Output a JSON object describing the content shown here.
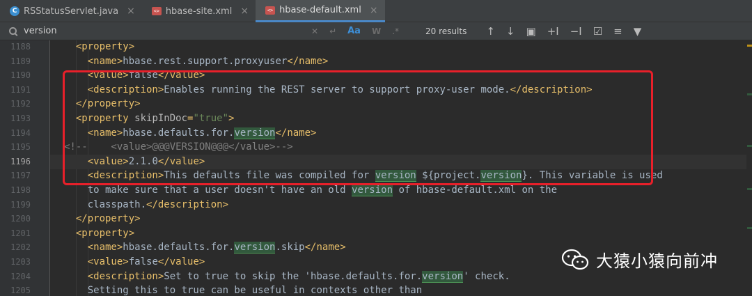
{
  "tabs": [
    {
      "label": "RSStatusServlet.java",
      "icon": "java-class-icon",
      "active": false
    },
    {
      "label": "hbase-site.xml",
      "icon": "xml-file-icon",
      "active": false
    },
    {
      "label": "hbase-default.xml",
      "icon": "xml-file-icon",
      "active": true
    }
  ],
  "search": {
    "query": "version",
    "results": "20 results",
    "match_case_label": "Aa",
    "words_label": "W",
    "regex_label": ".*"
  },
  "editor": {
    "lines": [
      {
        "n": "1188",
        "indent": 2,
        "parts": [
          [
            "tag",
            "<property>"
          ]
        ]
      },
      {
        "n": "1189",
        "indent": 4,
        "parts": [
          [
            "tag",
            "<name>"
          ],
          [
            "txt",
            "hbase.rest.support.proxyuser"
          ],
          [
            "tag",
            "</name>"
          ]
        ]
      },
      {
        "n": "1190",
        "indent": 4,
        "parts": [
          [
            "tag",
            "<value>"
          ],
          [
            "txt",
            "false"
          ],
          [
            "tag",
            "</value>"
          ]
        ]
      },
      {
        "n": "1191",
        "indent": 4,
        "parts": [
          [
            "tag",
            "<description>"
          ],
          [
            "txt",
            "Enables running the REST server to support proxy-user mode."
          ],
          [
            "tag",
            "</description>"
          ]
        ]
      },
      {
        "n": "1192",
        "indent": 2,
        "parts": [
          [
            "tag",
            "</property>"
          ]
        ]
      },
      {
        "n": "1193",
        "indent": 2,
        "parts": [
          [
            "tag",
            "<property "
          ],
          [
            "attr",
            "skipInDoc"
          ],
          [
            "tag",
            "="
          ],
          [
            "str",
            "\"true\""
          ],
          [
            "tag",
            ">"
          ]
        ]
      },
      {
        "n": "1194",
        "indent": 4,
        "parts": [
          [
            "tag",
            "<name>"
          ],
          [
            "txt",
            "hbase.defaults.for."
          ],
          [
            "hl",
            "version"
          ],
          [
            "tag",
            "</name>"
          ]
        ]
      },
      {
        "n": "1195",
        "indent": 0,
        "parts": [
          [
            "cmt",
            "<!--    <value>@@@VERSION@@@</value>-->"
          ]
        ]
      },
      {
        "n": "1196",
        "indent": 4,
        "current": true,
        "parts": [
          [
            "tag",
            "<value>"
          ],
          [
            "txt",
            "2.1.0"
          ],
          [
            "tag",
            "</value>"
          ]
        ]
      },
      {
        "n": "1197",
        "indent": 4,
        "parts": [
          [
            "tag",
            "<description>"
          ],
          [
            "txt",
            "This defaults file was compiled for "
          ],
          [
            "hl",
            "version"
          ],
          [
            "txt",
            " ${project."
          ],
          [
            "hl",
            "version"
          ],
          [
            "txt",
            "}. This variable is used"
          ]
        ]
      },
      {
        "n": "1198",
        "indent": 4,
        "parts": [
          [
            "txt",
            "to make sure that a user doesn't have an old "
          ],
          [
            "hl",
            "version"
          ],
          [
            "txt",
            " of hbase-default.xml on the"
          ]
        ]
      },
      {
        "n": "1199",
        "indent": 4,
        "parts": [
          [
            "txt",
            "classpath."
          ],
          [
            "tag",
            "</description>"
          ]
        ]
      },
      {
        "n": "1200",
        "indent": 2,
        "parts": [
          [
            "tag",
            "</property>"
          ]
        ]
      },
      {
        "n": "1201",
        "indent": 2,
        "parts": [
          [
            "tag",
            "<property>"
          ]
        ]
      },
      {
        "n": "1202",
        "indent": 4,
        "parts": [
          [
            "tag",
            "<name>"
          ],
          [
            "txt",
            "hbase.defaults.for."
          ],
          [
            "hl",
            "version"
          ],
          [
            "txt",
            ".skip"
          ],
          [
            "tag",
            "</name>"
          ]
        ]
      },
      {
        "n": "1203",
        "indent": 4,
        "parts": [
          [
            "tag",
            "<value>"
          ],
          [
            "txt",
            "false"
          ],
          [
            "tag",
            "</value>"
          ]
        ]
      },
      {
        "n": "1204",
        "indent": 4,
        "parts": [
          [
            "tag",
            "<description>"
          ],
          [
            "txt",
            "Set to true to skip the 'hbase.defaults.for."
          ],
          [
            "hl",
            "version"
          ],
          [
            "txt",
            "' check."
          ]
        ]
      },
      {
        "n": "1205",
        "indent": 4,
        "parts": [
          [
            "txt",
            "Setting this to true can be useful in contexts other than"
          ]
        ]
      }
    ]
  },
  "watermark": {
    "text": "大猿小猿向前冲"
  },
  "colors": {
    "accent": "#4a88c7",
    "highlight": "#32593d",
    "redbox": "#e8202a"
  }
}
